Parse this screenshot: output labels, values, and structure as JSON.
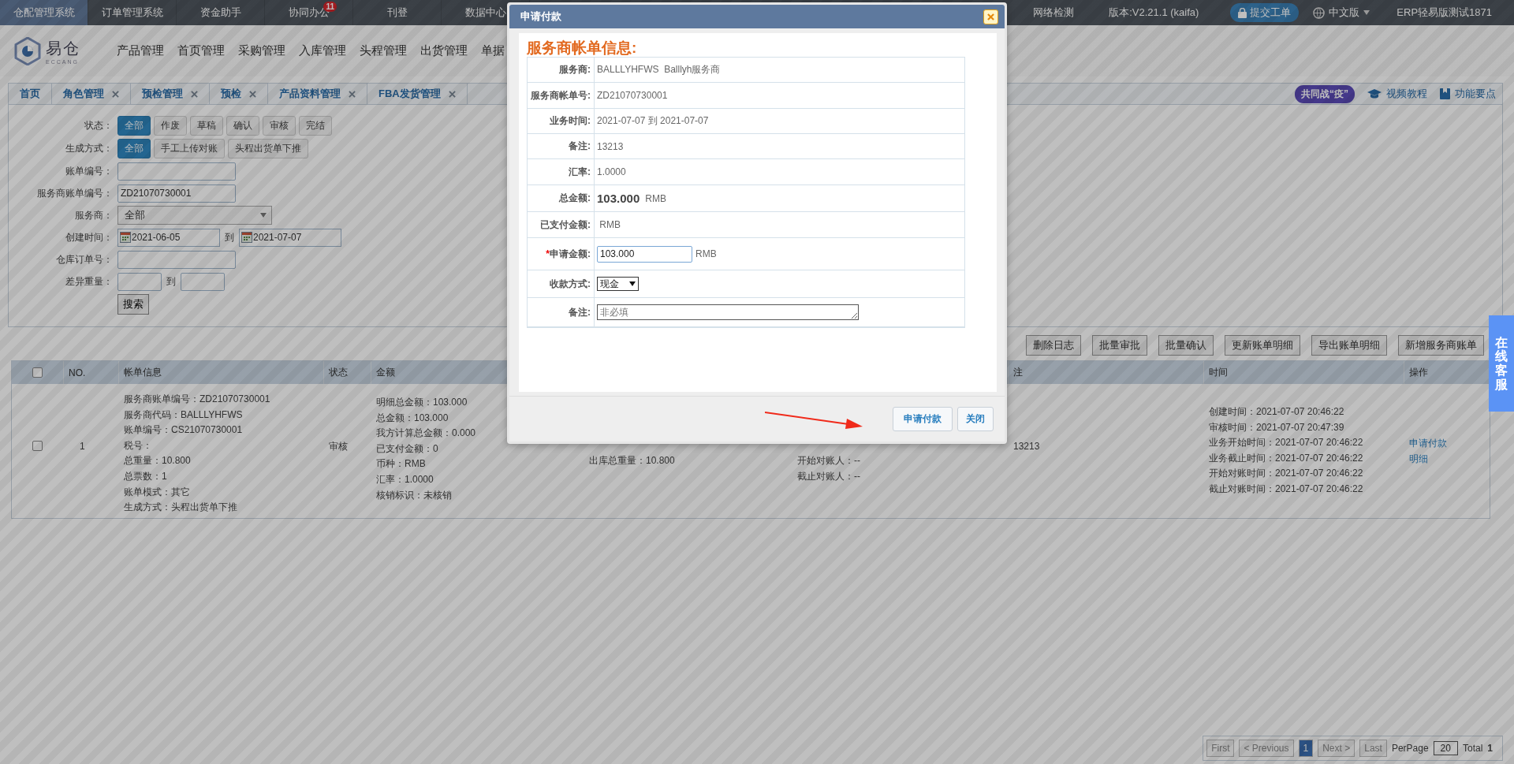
{
  "top_bar": {
    "systems": [
      {
        "label": "仓配管理系统",
        "selected": true
      },
      {
        "label": "订单管理系统",
        "selected": false
      },
      {
        "label": "资金助手",
        "selected": false
      },
      {
        "label": "协同办公",
        "selected": false,
        "badge": "11"
      },
      {
        "label": "刊登",
        "selected": false
      },
      {
        "label": "数据中心",
        "selected": false
      }
    ],
    "network": "网络检测",
    "version": "版本:V2.21.1 (kaifa)",
    "ticket_button": "提交工单",
    "language": "中文版",
    "account": "ERP轻易版测试1871"
  },
  "header": {
    "logo": "易仓",
    "logo_sub": "ECCANG",
    "nav": [
      "产品管理",
      "首页管理",
      "采购管理",
      "入库管理",
      "头程管理",
      "出货管理",
      "单据"
    ]
  },
  "tabs": [
    {
      "label": "首页",
      "closable": false
    },
    {
      "label": "角色管理",
      "closable": true
    },
    {
      "label": "预检管理",
      "closable": true
    },
    {
      "label": "预检",
      "closable": true
    },
    {
      "label": "产品资料管理",
      "closable": true
    },
    {
      "label": "FBA发货管理",
      "closable": true
    }
  ],
  "tab_tools": {
    "campaign": "共同战“疫”",
    "video": "视频教程",
    "features": "功能要点"
  },
  "filters": [
    {
      "kind": "buttons",
      "label": "状态：",
      "options": [
        {
          "label": "全部",
          "selected": true
        },
        {
          "label": "作废",
          "selected": false
        },
        {
          "label": "草稿",
          "selected": false
        },
        {
          "label": "确认",
          "selected": false
        },
        {
          "label": "审核",
          "selected": false
        },
        {
          "label": "完结",
          "selected": false
        }
      ]
    },
    {
      "kind": "buttons",
      "label": "生成方式：",
      "options": [
        {
          "label": "全部",
          "selected": true
        },
        {
          "label": "手工上传对账",
          "selected": false
        },
        {
          "label": "头程出货单下推",
          "selected": false
        }
      ]
    },
    {
      "kind": "input",
      "label": "账单编号："
    },
    {
      "kind": "input",
      "label": "服务商账单编号：",
      "value": "ZD21070730001"
    },
    {
      "kind": "select",
      "label": "服务商：",
      "value": "全部"
    },
    {
      "kind": "date_range",
      "label": "创建时间：",
      "from": "2021-06-05",
      "separator": "到",
      "to": "2021-07-07"
    },
    {
      "kind": "input",
      "label": "仓库订单号："
    },
    {
      "kind": "range",
      "label": "差异重量：",
      "separator": "到"
    },
    {
      "kind": "submit",
      "label": "搜索"
    }
  ],
  "toolbar_buttons": [
    "删除日志",
    "批量审批",
    "批量确认",
    "更新账单明细",
    "导出账单明细",
    "新增服务商账单"
  ],
  "table": {
    "columns": [
      {
        "kind": "checkbox",
        "checked": false
      },
      {
        "label": "NO."
      },
      {
        "label": "帐单信息"
      },
      {
        "label": "状态"
      },
      {
        "label": "金额"
      },
      {},
      {},
      {
        "label": "注"
      },
      {
        "label": "时间"
      },
      {
        "label": "操作"
      }
    ],
    "rows": [
      {
        "checked": false,
        "no": "1",
        "bill_info": [
          "服务商账单编号：ZD21070730001",
          "服务商代码：BALLLYHFWS",
          "账单编号：CS21070730001",
          "税号：",
          "总重量：10.800",
          "总票数：1",
          "账单模式：其它",
          "生成方式：头程出货单下推"
        ],
        "status": "审核",
        "amount": [
          "明细总金额：103.000",
          "总金额：103.000",
          "我方计算总金额：0.000",
          "已支付金额：0",
          "币种：RMB",
          "汇率：1.0000",
          "核销标识：未核销"
        ],
        "column_6": [
          "出库总重量：10.800"
        ],
        "column_7": [
          "开始对账人：--",
          "截止对账人：--"
        ],
        "remark": "13213",
        "time": [
          "创建时间：2021-07-07 20:46:22",
          "审核时间：2021-07-07 20:47:39",
          "业务开始时间：2021-07-07 20:46:22",
          "业务截止时间：2021-07-07 20:46:22",
          "开始对账时间：2021-07-07 20:46:22",
          "截止对账时间：2021-07-07 20:46:22"
        ],
        "actions": [
          "申请付款",
          "明细"
        ]
      }
    ]
  },
  "pagination": {
    "first": "First",
    "previous": "< Previous",
    "pages": [
      {
        "label": "1",
        "selected": true
      }
    ],
    "next": "Next >",
    "last": "Last",
    "per_page_label": "PerPage",
    "per_page": "20",
    "total_label": "Total",
    "total": "1"
  },
  "side_tab": "在线客服",
  "dialog": {
    "title": "申请付款",
    "heading": "服务商帐单信息:",
    "rows": [
      {
        "kind": "text",
        "label": "服务商:",
        "value": "BALLLYHFWS  Balllyh服务商"
      },
      {
        "kind": "text",
        "label": "服务商帐单号:",
        "value": "ZD21070730001"
      },
      {
        "kind": "text",
        "label": "业务时间:",
        "value": "2021-07-07 到 2021-07-07"
      },
      {
        "kind": "text",
        "label": "备注:",
        "value": "13213"
      },
      {
        "kind": "text",
        "label": "汇率:",
        "value": "1.0000"
      },
      {
        "kind": "amount",
        "label": "总金额:",
        "value": "103.000",
        "unit": "RMB"
      },
      {
        "kind": "text",
        "label": "已支付金额:",
        "value": " RMB"
      },
      {
        "kind": "input",
        "label": "申请金额:",
        "required_mark": "*",
        "value": "103.000",
        "unit": "RMB"
      },
      {
        "kind": "select",
        "label": "收款方式:",
        "value": "现金"
      },
      {
        "kind": "textarea",
        "label": "备注:",
        "placeholder": "非必填"
      }
    ],
    "buttons": [
      {
        "label": "申请付款",
        "kind": "primary"
      },
      {
        "label": "关闭",
        "kind": "secondary"
      }
    ]
  }
}
